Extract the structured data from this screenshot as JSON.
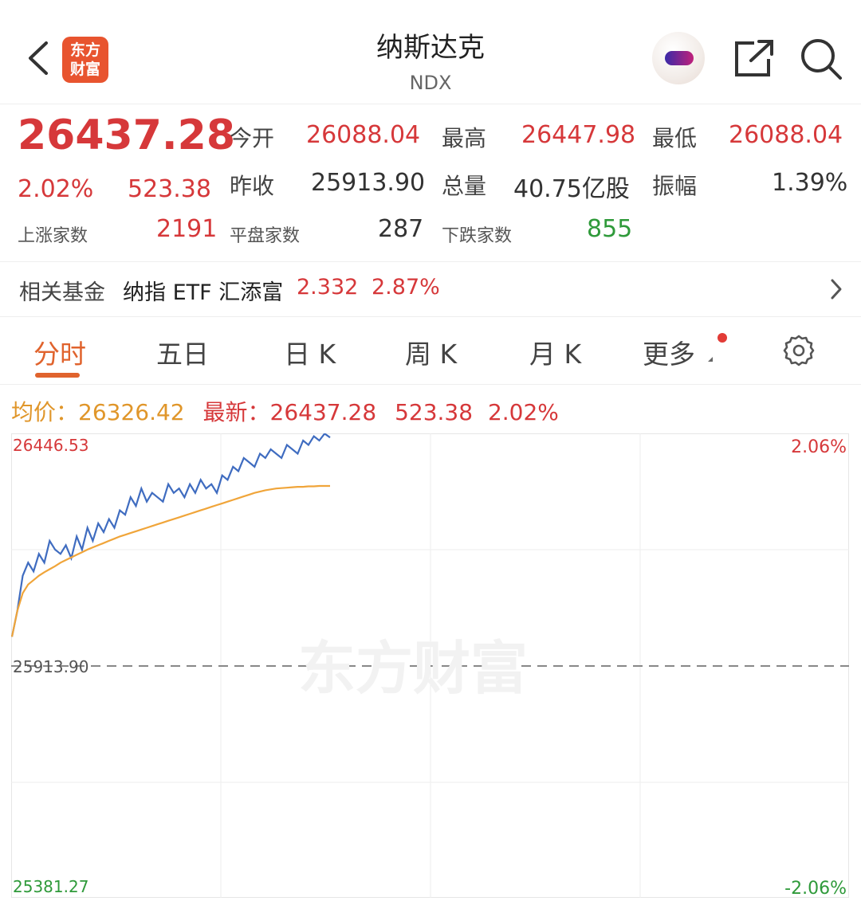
{
  "header": {
    "logo_text": "东方财富",
    "title": "纳斯达克",
    "subtitle": "NDX"
  },
  "quote": {
    "price": "26437.28",
    "change_pct": "2.02%",
    "change": "523.38",
    "open_label": "今开",
    "open": "26088.04",
    "high_label": "最高",
    "high": "26447.98",
    "low_label": "最低",
    "low": "26088.04",
    "prev_close_label": "昨收",
    "prev_close": "25913.90",
    "volume_label": "总量",
    "volume": "40.75亿股",
    "amplitude_label": "振幅",
    "amplitude": "1.39%",
    "up_label": "上涨家数",
    "up": "2191",
    "flat_label": "平盘家数",
    "flat": "287",
    "down_label": "下跌家数",
    "down": "855"
  },
  "fund": {
    "label": "相关基金",
    "name": "纳指 ETF 汇添富",
    "price": "2.332",
    "change_pct": "2.87%"
  },
  "tabs": [
    "分时",
    "五日",
    "日 K",
    "周 K",
    "月 K",
    "更多"
  ],
  "info": {
    "avg_label": "均价：",
    "avg": "26326.42",
    "latest_label": "最新：",
    "latest": "26437.28",
    "change": "523.38",
    "change_pct": "2.02%"
  },
  "chart_data": {
    "type": "line",
    "y_max_label": "26446.53",
    "y_mid_label": "25913.90",
    "y_min_label": "25381.27",
    "pct_max_label": "2.06%",
    "pct_min_label": "-2.06%",
    "watermark": "东方财富",
    "ylim": [
      25381.27,
      26446.53
    ],
    "session_progress": 0.38,
    "series": [
      {
        "color": "#3f6cc0",
        "values": [
          25980,
          26040,
          26120,
          26150,
          26130,
          26170,
          26150,
          26200,
          26180,
          26170,
          26190,
          26160,
          26210,
          26180,
          26230,
          26200,
          26240,
          26220,
          26250,
          26230,
          26270,
          26260,
          26300,
          26280,
          26320,
          26290,
          26310,
          26300,
          26290,
          26330,
          26310,
          26320,
          26300,
          26330,
          26310,
          26340,
          26320,
          26330,
          26310,
          26350,
          26340,
          26370,
          26360,
          26390,
          26380,
          26370,
          26400,
          26390,
          26410,
          26400,
          26390,
          26420,
          26410,
          26400,
          26430,
          26420,
          26440,
          26430,
          26446,
          26437
        ]
      },
      {
        "color": "#f0a53a",
        "values": [
          25980,
          26040,
          26080,
          26100,
          26110,
          26120,
          26128,
          26135,
          26142,
          26150,
          26156,
          26162,
          26168,
          26174,
          26180,
          26185,
          26190,
          26195,
          26200,
          26205,
          26210,
          26214,
          26218,
          26222,
          26226,
          26230,
          26234,
          26238,
          26242,
          26246,
          26250,
          26254,
          26258,
          26262,
          26266,
          26270,
          26274,
          26278,
          26282,
          26286,
          26290,
          26294,
          26298,
          26302,
          26306,
          26310,
          26313,
          26316,
          26318,
          26320,
          26321,
          26322,
          26323,
          26324,
          26324,
          26325,
          26325,
          26326,
          26326,
          26326
        ]
      }
    ]
  },
  "colors": {
    "accent": "#e0632d",
    "up": "#d6383a",
    "down": "#2f9a3a"
  },
  "icons": [
    "back-icon",
    "share-icon",
    "search-icon",
    "chevron-right-icon",
    "gear-icon"
  ]
}
